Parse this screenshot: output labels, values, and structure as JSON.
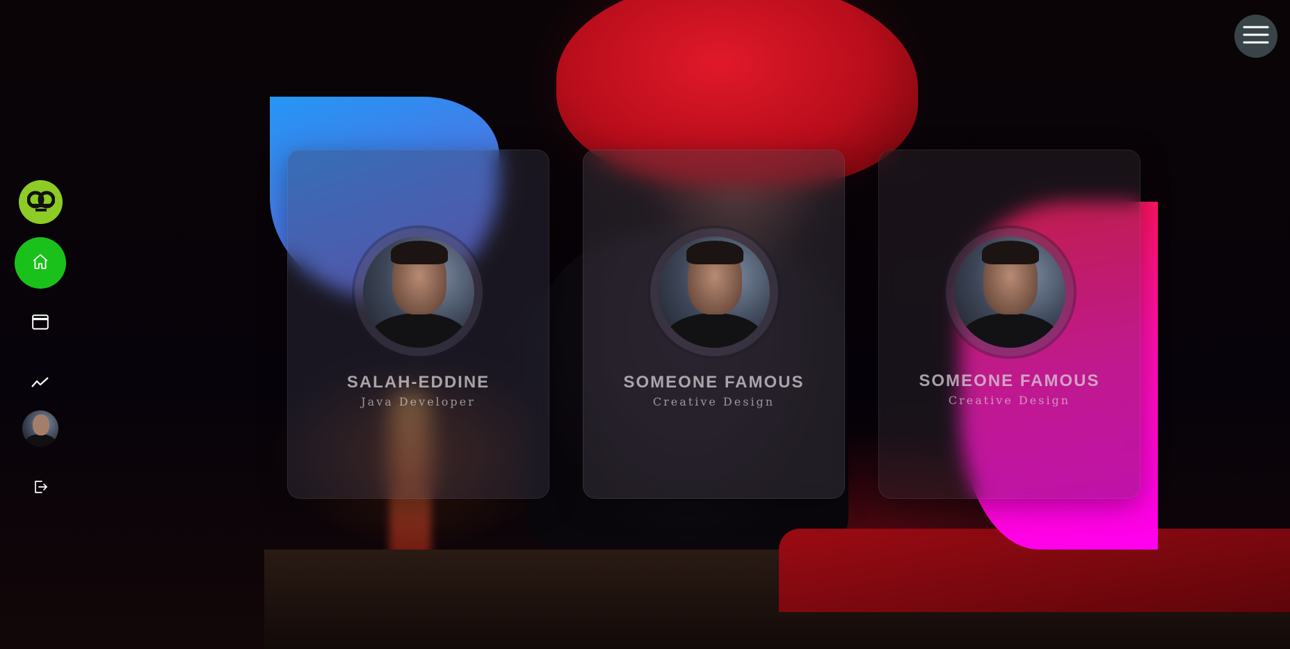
{
  "cards": [
    {
      "name": "SALAH-EDDINE",
      "role": "Java Developer"
    },
    {
      "name": "SOMEONE FAMOUS",
      "role": "Creative Design"
    },
    {
      "name": "SOMEONE FAMOUS",
      "role": "Creative Design"
    }
  ],
  "sidebar": {
    "items": [
      {
        "icon": "logo-icon"
      },
      {
        "icon": "home-icon",
        "active": true
      },
      {
        "icon": "window-icon"
      },
      {
        "icon": "chart-icon"
      },
      {
        "icon": "avatar"
      },
      {
        "icon": "logout-icon"
      }
    ]
  },
  "header": {
    "menu_icon": "hamburger-menu-icon"
  },
  "colors": {
    "logo_green": "#8ccc25",
    "active_green": "#1bc11b",
    "blob_blue": "#2596f5",
    "blob_pink": "#ff0fb0",
    "menu_button": "#394448"
  }
}
